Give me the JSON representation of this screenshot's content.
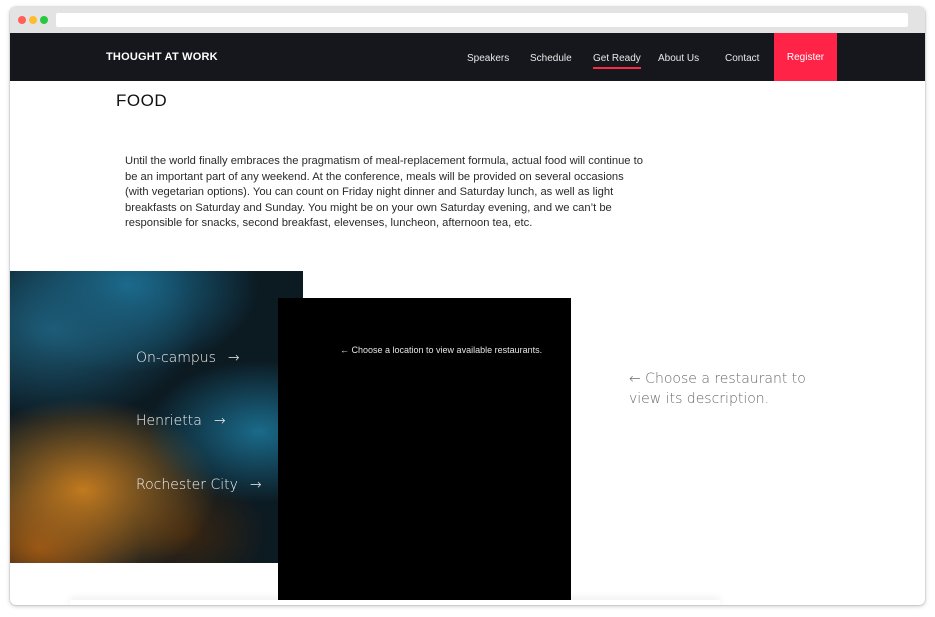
{
  "site": {
    "brand": "THOUGHT AT WORK"
  },
  "nav": {
    "links": [
      "Speakers",
      "Schedule",
      "Get Ready",
      "About Us",
      "Contact"
    ],
    "active": "Get Ready",
    "register_label": "Register",
    "accent_color": "#ff2447"
  },
  "page": {
    "title": "FOOD",
    "intro": "Until the world finally embraces the pragmatism of meal-replacement formula, actual food will continue to be an important part of any weekend. At the conference, meals will be provided on several occasions (with vegetarian options). You can count on Friday night dinner and Saturday lunch, as well as light breakfasts on Saturday and Sunday. You might be on your own Saturday evening, and we can’t be responsible for snacks, second breakfast, elevenses, luncheon, afternoon tea, etc."
  },
  "locations": {
    "items": [
      "On-campus",
      "Henrietta",
      "Rochester City"
    ],
    "arrow_glyph": "→"
  },
  "restaurants": {
    "panel_hint": "← Choose a location to view available restaurants.",
    "description_hint": "← Choose a restaurant to view its description."
  }
}
